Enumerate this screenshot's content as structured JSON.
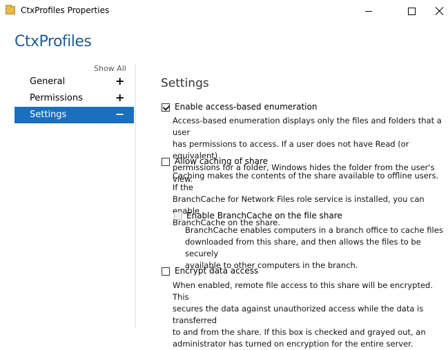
{
  "window": {
    "title": "CtxProfiles Properties"
  },
  "header": {
    "title": "CtxProfiles"
  },
  "nav": {
    "show_all": "Show All",
    "items": [
      {
        "label": "General",
        "sign": "+"
      },
      {
        "label": "Permissions",
        "sign": "+"
      },
      {
        "label": "Settings",
        "sign": "−"
      }
    ]
  },
  "main": {
    "section_title": "Settings",
    "options": [
      {
        "label": "Enable access-based enumeration",
        "checked": true,
        "desc_lines": [
          "Access-based enumeration displays only the files and folders that a user",
          "has permissions to access. If a user does not have Read (or equivalent)",
          "permissions for a folder, Windows hides the folder from the user's view."
        ]
      },
      {
        "label": "Allow caching of share",
        "checked": false,
        "desc_lines": [
          "Caching makes the contents of the share available to offline users. If the",
          "BranchCache for Network Files role service is installed, you can enable",
          "BranchCache on the share."
        ]
      },
      {
        "label": "Enable BranchCache on the file share",
        "checked": false,
        "disabled": true,
        "desc_lines": [
          "BranchCache enables computers in a branch office to cache files",
          "downloaded from this share, and then allows the files to be securely",
          "available to other computers in the branch."
        ]
      },
      {
        "label": "Encrypt data access",
        "checked": false,
        "desc_lines": [
          "When enabled, remote file access to this share will be encrypted. This",
          "secures the data against unauthorized access while the data is transferred",
          "to and from the share. If this box is checked and grayed out, an",
          "administrator has turned on encryption for the entire server."
        ]
      }
    ]
  }
}
